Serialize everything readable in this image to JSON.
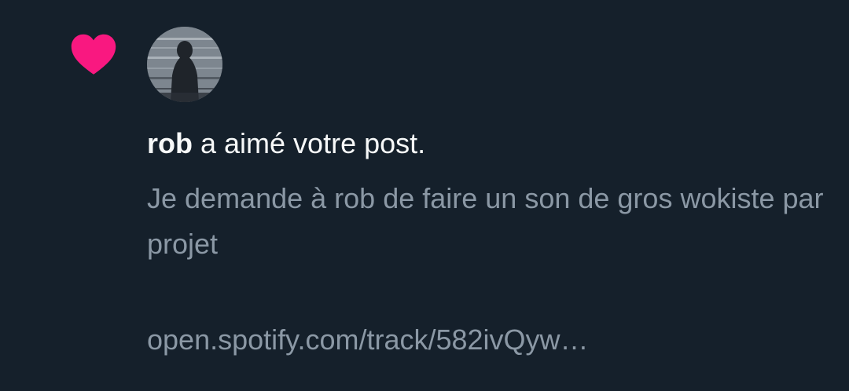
{
  "notification": {
    "icon": "heart-icon",
    "icon_color": "#f91880",
    "user_name": "rob",
    "action_text": " a aimé votre post.",
    "post_text": "Je demande à rob de faire un son de gros wokiste par projet",
    "post_link": "open.spotify.com/track/582ivQyw…"
  },
  "colors": {
    "background": "#15202b",
    "primary_text": "#f7f9f9",
    "secondary_text": "#8b98a5"
  }
}
